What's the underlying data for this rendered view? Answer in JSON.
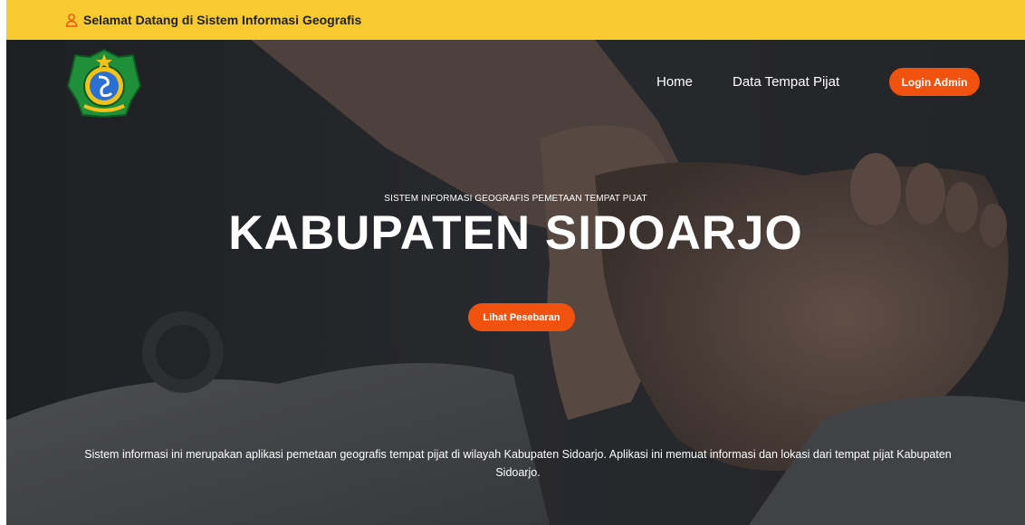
{
  "topbar": {
    "welcome_text": "Selamat Datang di Sistem Informasi Geografis",
    "icon": "user-icon"
  },
  "header": {
    "logo": "kabupaten-sidoarjo-emblem",
    "nav": [
      {
        "label": "Home"
      },
      {
        "label": "Data Tempat Pijat"
      }
    ],
    "login_label": "Login Admin"
  },
  "hero": {
    "subtitle": "SISTEM INFORMASI GEOGRAFIS PEMETAAN TEMPAT PIJAT",
    "title": "KABUPATEN SIDOARJO",
    "cta_label": "Lihat Pesebaran",
    "description": "Sistem informasi ini merupakan aplikasi pemetaan geografis tempat pijat di wilayah Kabupaten Sidoarjo. Aplikasi ini memuat informasi dan lokasi dari tempat pijat Kabupaten Sidoarjo."
  },
  "colors": {
    "topbar": "#f7cb2f",
    "accent": "#f1520f",
    "overlay": "#2a2c2f"
  }
}
